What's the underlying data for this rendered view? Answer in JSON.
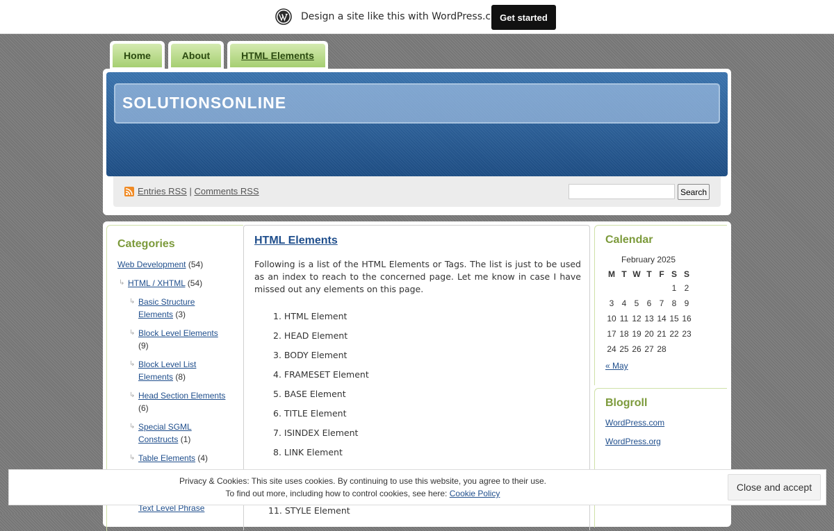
{
  "wp_banner": {
    "text": "Design a site like this with WordPress.com",
    "button": "Get started"
  },
  "nav": {
    "tabs": [
      {
        "label": "Home"
      },
      {
        "label": "About"
      },
      {
        "label": "HTML Elements"
      }
    ]
  },
  "site": {
    "title": "SOLUTIONSONLINE"
  },
  "feeds": {
    "entries": "Entries RSS",
    "separator": "|",
    "comments": "Comments RSS"
  },
  "search": {
    "button": "Search",
    "value": ""
  },
  "categories": {
    "title": "Categories",
    "items": [
      {
        "label": "Web Development",
        "count": "(54)"
      },
      {
        "label": "HTML / XHTML",
        "count": "(54)"
      },
      {
        "label": "Basic Structure Elements",
        "count": "(3)"
      },
      {
        "label": "Block Level Elements",
        "count": "(9)"
      },
      {
        "label": "Block Level List Elements",
        "count": "(8)"
      },
      {
        "label": "Head Section Elements",
        "count": "(6)"
      },
      {
        "label": "Special SGML Constructs",
        "count": "(1)"
      },
      {
        "label": "Table Elements",
        "count": "(4)"
      },
      {
        "label": "Text Level Phrase",
        "count": ""
      }
    ]
  },
  "post": {
    "title": "HTML Elements",
    "intro": "Following is a list of the HTML Elements or Tags. The list is just to be used as an index to reach to the concerned page. Let me know in case I have missed out any elements on this page.",
    "list": [
      {
        "n": "1.",
        "label": "HTML Element"
      },
      {
        "n": "2.",
        "label": "HEAD Element"
      },
      {
        "n": "3.",
        "label": "BODY Element"
      },
      {
        "n": "4.",
        "label": "FRAMESET Element"
      },
      {
        "n": "5.",
        "label": "BASE Element"
      },
      {
        "n": "6.",
        "label": "TITLE Element"
      },
      {
        "n": "7.",
        "label": "ISINDEX Element"
      },
      {
        "n": "8.",
        "label": "LINK Element"
      },
      {
        "n": "11.",
        "label": "STYLE Element"
      }
    ]
  },
  "calendar": {
    "title": "Calendar",
    "caption": "February 2025",
    "days": [
      "M",
      "T",
      "W",
      "T",
      "F",
      "S",
      "S"
    ],
    "weeks": [
      [
        "",
        "",
        "",
        "",
        "",
        "1",
        "2"
      ],
      [
        "3",
        "4",
        "5",
        "6",
        "7",
        "8",
        "9"
      ],
      [
        "10",
        "11",
        "12",
        "13",
        "14",
        "15",
        "16"
      ],
      [
        "17",
        "18",
        "19",
        "20",
        "21",
        "22",
        "23"
      ],
      [
        "24",
        "25",
        "26",
        "27",
        "28",
        "",
        ""
      ]
    ],
    "prev": "« May"
  },
  "blogroll": {
    "title": "Blogroll",
    "links": [
      "WordPress.com",
      "WordPress.org"
    ]
  },
  "cookie": {
    "line1": "Privacy & Cookies: This site uses cookies. By continuing to use this website, you agree to their use.",
    "line2": "To find out more, including how to control cookies, see here:",
    "policy": "Cookie Policy",
    "button": "Close and accept"
  }
}
